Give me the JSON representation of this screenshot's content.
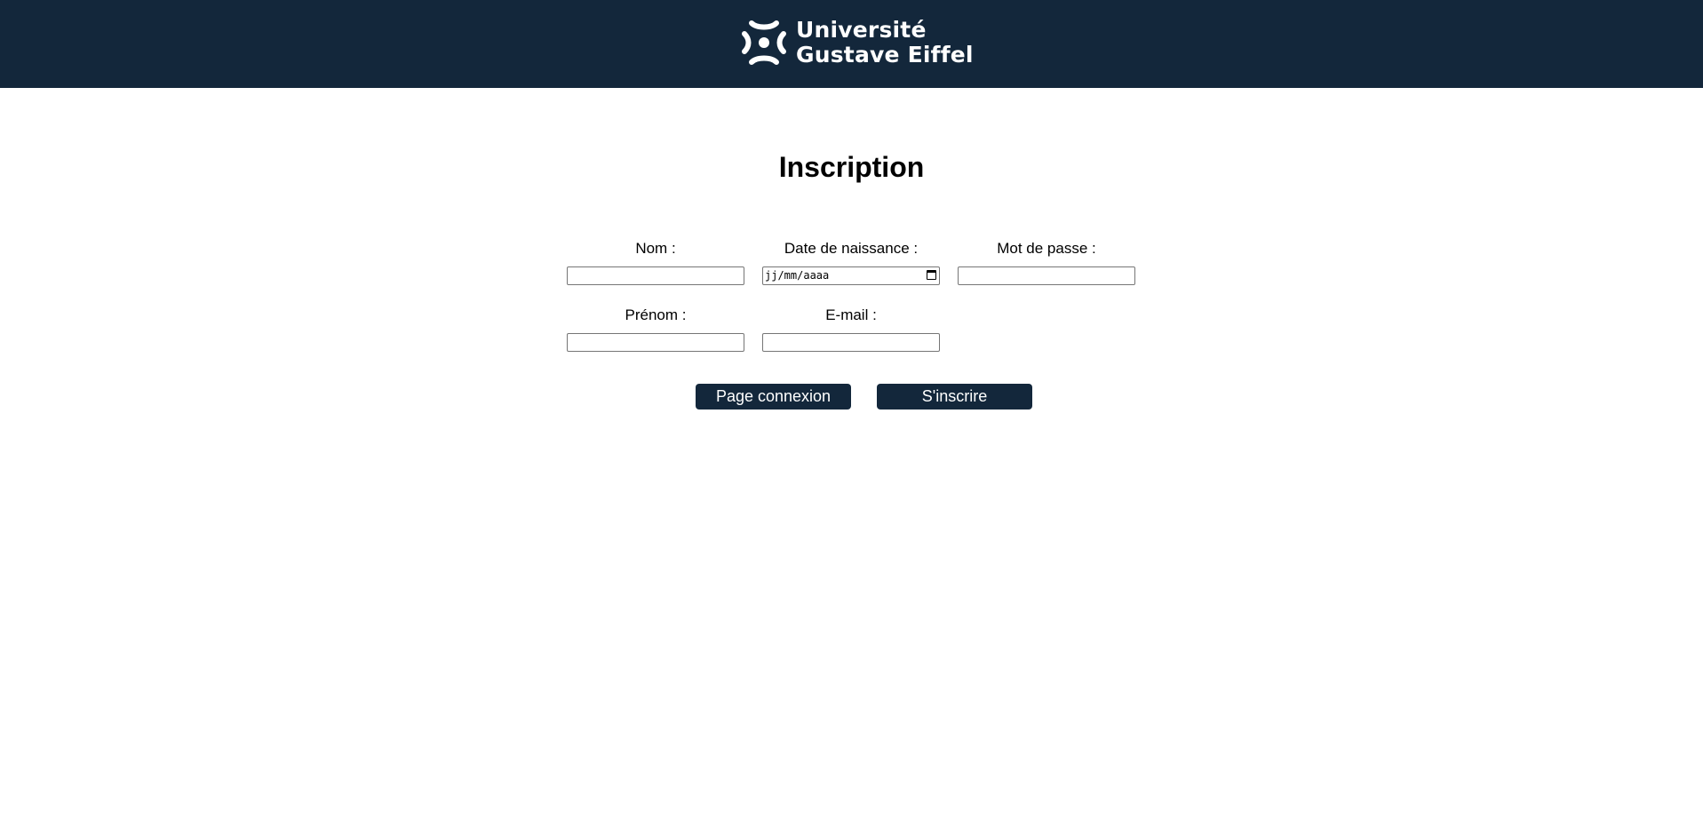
{
  "header": {
    "logo_line1": "Université",
    "logo_line2": "Gustave Eiffel",
    "background": "#13273b"
  },
  "page": {
    "title": "Inscription"
  },
  "form": {
    "nom_label": "Nom :",
    "date_label": "Date de naissance :",
    "date_placeholder": "jj/mm/aaaa",
    "password_label": "Mot de passe :",
    "prenom_label": "Prénom :",
    "email_label": "E-mail :"
  },
  "buttons": {
    "connexion_label": "Page connexion",
    "inscrire_label": "S'inscrire",
    "color": "#13273b"
  },
  "icons": {
    "logo": "university-logo-icon",
    "calendar": "calendar-icon"
  }
}
